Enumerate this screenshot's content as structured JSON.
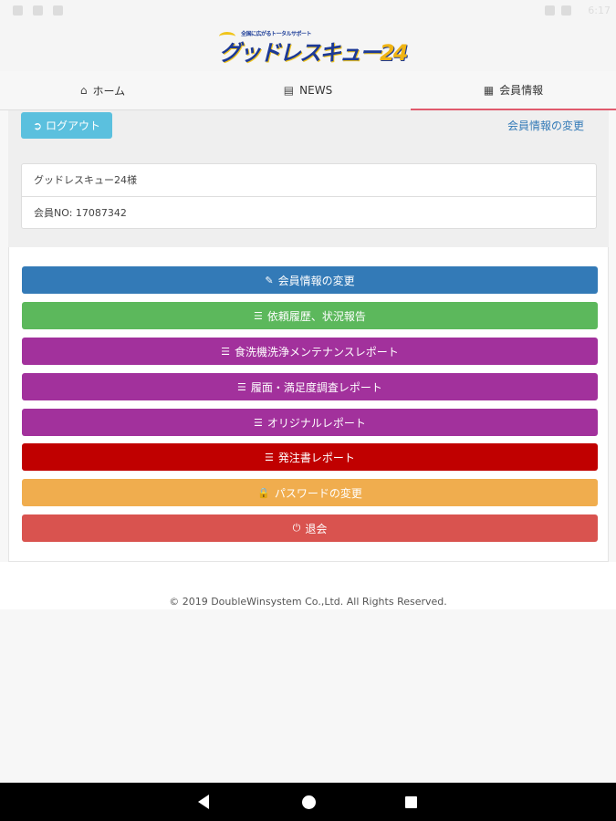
{
  "app": {
    "logo_tagline": "全国に広がるトータルサポート",
    "logo_text": "グッドレスキュー",
    "logo_number": "24"
  },
  "status_bar": {
    "time": "6:17"
  },
  "nav": {
    "tabs": [
      {
        "icon": "home-icon",
        "label": "ホーム",
        "active": false
      },
      {
        "icon": "news-icon",
        "label": "NEWS",
        "active": false
      },
      {
        "icon": "member-card-icon",
        "label": "会員情報",
        "active": true
      }
    ]
  },
  "toolbar": {
    "logout_label": "ログアウト",
    "change_link": "会員情報の変更"
  },
  "member": {
    "name": "グッドレスキュー24様",
    "number": "会員NO: 17087342"
  },
  "menu": {
    "buttons": [
      {
        "label": "会員情報の変更",
        "icon": "edit-icon",
        "color": "#337ab7"
      },
      {
        "label": "依頼履歴、状況報告",
        "icon": "list-icon",
        "color": "#5cb85c"
      },
      {
        "label": "食洗機洗浄メンテナンスレポート",
        "icon": "list-icon",
        "color": "#a2319c"
      },
      {
        "label": "履面・満足度調査レポート",
        "icon": "list-icon",
        "color": "#a2319c"
      },
      {
        "label": "オリジナルレポート",
        "icon": "list-icon",
        "color": "#a2319c"
      },
      {
        "label": "発注書レポート",
        "icon": "list-icon",
        "color": "#c00000"
      },
      {
        "label": "パスワードの変更",
        "icon": "lock-icon",
        "color": "#f0ad4e"
      },
      {
        "label": "退会",
        "icon": "power-icon",
        "color": "#d9534f"
      }
    ]
  },
  "footer": {
    "copyright": "© 2019 DoubleWinsystem Co.,Ltd. All Rights Reserved."
  },
  "colors": {
    "accent_tab_underline": "#e05a6d",
    "logout_button": "#5bc0de",
    "link": "#337ab7"
  }
}
